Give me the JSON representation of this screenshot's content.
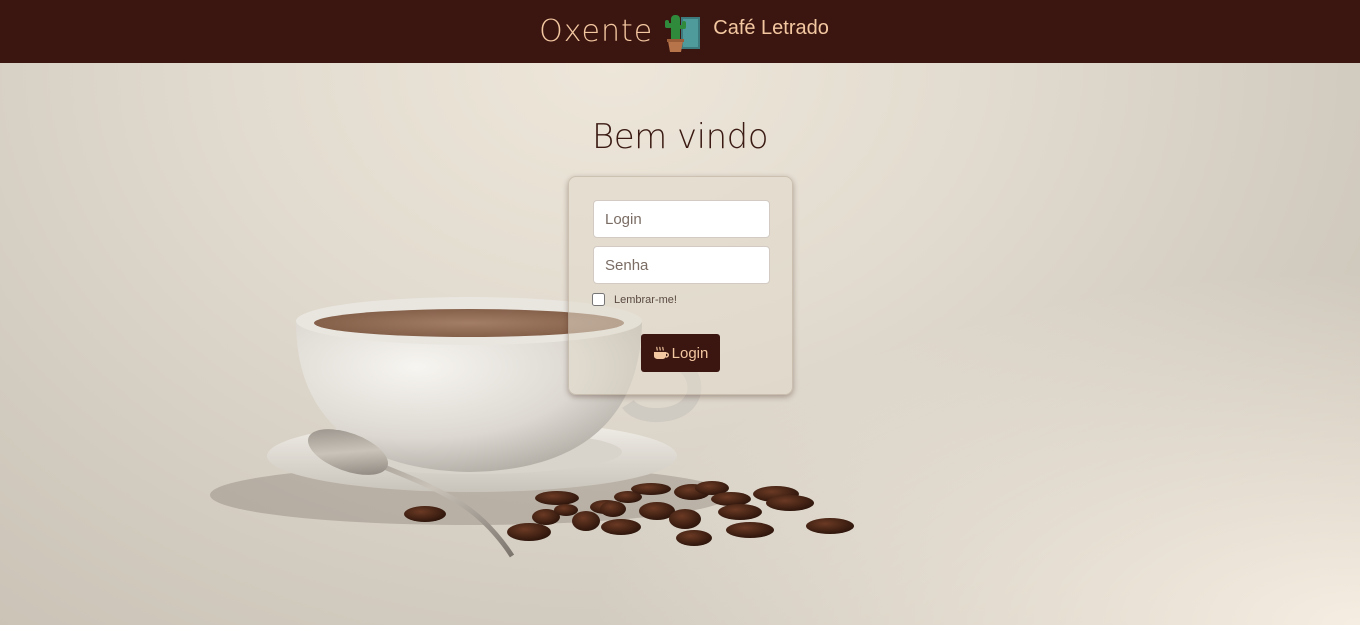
{
  "header": {
    "brand_name": "Oxente",
    "brand_subtitle": "Café Letrado",
    "logo_icon": "cactus-book-logo"
  },
  "main": {
    "title": "Bem vindo"
  },
  "form": {
    "login_placeholder": "Login",
    "password_placeholder": "Senha",
    "remember_label": "Lembrar-me!",
    "remember_checked": false,
    "submit_label": "Login",
    "submit_icon": "coffee-cup-icon"
  },
  "colors": {
    "header_bg": "#3b1611",
    "accent_text": "#f3c7a0",
    "button_bg": "#3b1611",
    "title_text": "#3a1a12"
  }
}
